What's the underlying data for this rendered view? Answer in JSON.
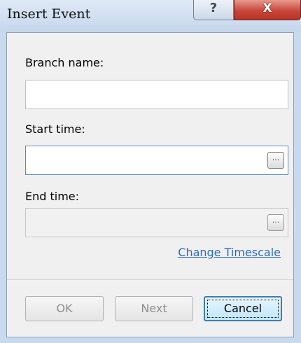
{
  "window": {
    "title": "Insert Event",
    "help_glyph": "?",
    "close_glyph": "X"
  },
  "form": {
    "branch_name": {
      "label": "Branch name:",
      "value": ""
    },
    "start_time": {
      "label": "Start time:",
      "value": "",
      "picker_label": "..."
    },
    "end_time": {
      "label": "End time:",
      "value": "",
      "picker_label": "...",
      "enabled": false
    },
    "change_timescale_link": "Change Timescale"
  },
  "buttons": {
    "ok": {
      "label": "OK",
      "enabled": false
    },
    "next": {
      "label": "Next",
      "enabled": false
    },
    "cancel": {
      "label": "Cancel",
      "enabled": true,
      "default": true
    }
  }
}
